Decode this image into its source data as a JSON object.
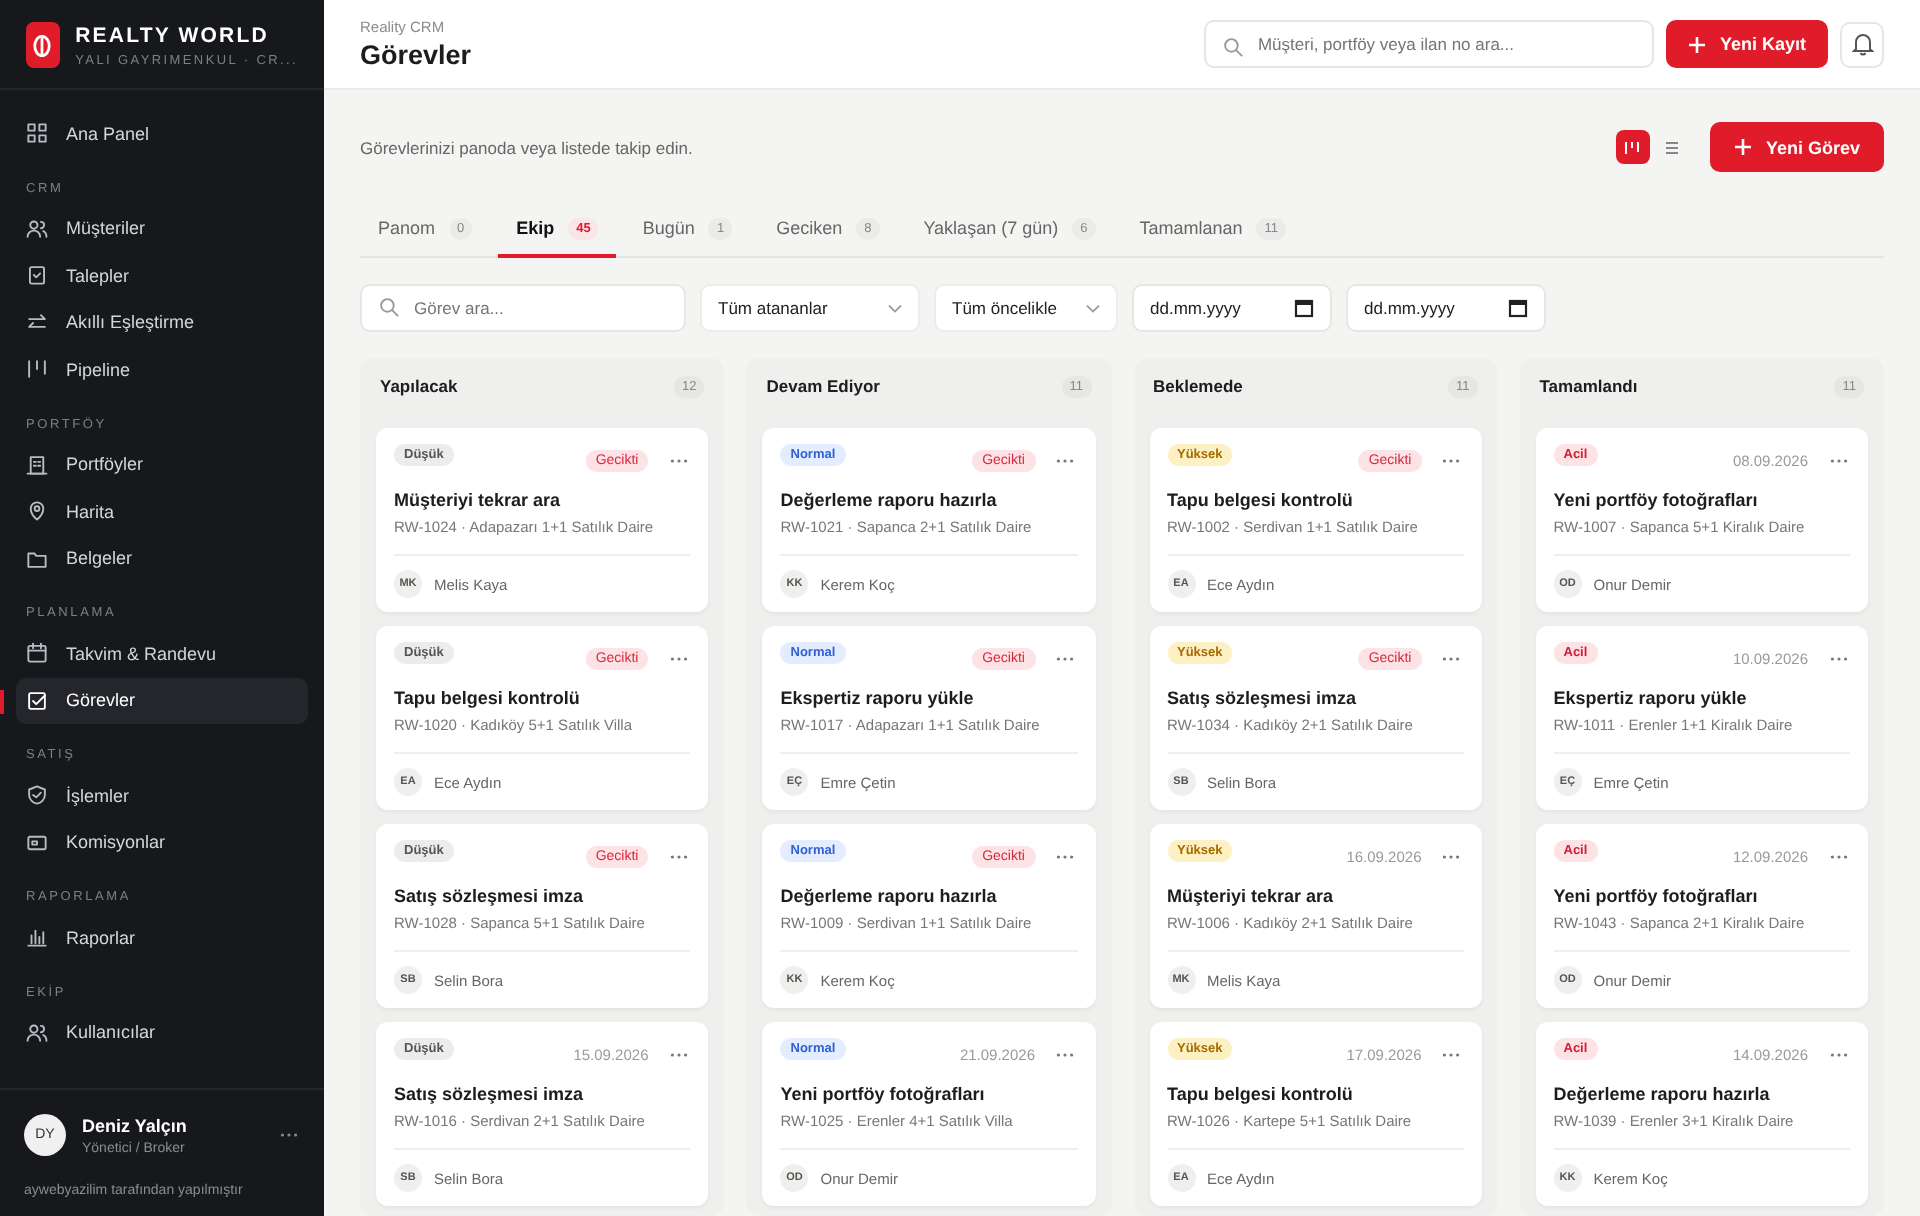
{
  "brand": {
    "name": "REALTY WORLD",
    "subtitle": "YALI GAYRIMENKUL · CR..."
  },
  "sidebar": {
    "sections": [
      {
        "items": [
          {
            "label": "Ana Panel",
            "selected": false
          }
        ]
      },
      {
        "heading": "CRM",
        "items": [
          {
            "label": "Müşteriler",
            "selected": false
          },
          {
            "label": "Talepler",
            "selected": false
          },
          {
            "label": "Akıllı Eşleştirme",
            "selected": false
          },
          {
            "label": "Pipeline",
            "selected": false
          }
        ]
      },
      {
        "heading": "PORTFÖY",
        "items": [
          {
            "label": "Portföyler",
            "selected": false
          },
          {
            "label": "Harita",
            "selected": false
          },
          {
            "label": "Belgeler",
            "selected": false
          }
        ]
      },
      {
        "heading": "PLANLAMA",
        "items": [
          {
            "label": "Takvim & Randevu",
            "selected": false
          },
          {
            "label": "Görevler",
            "selected": true
          }
        ]
      },
      {
        "heading": "SATIŞ",
        "items": [
          {
            "label": "İşlemler",
            "selected": false
          },
          {
            "label": "Komisyonlar",
            "selected": false
          }
        ]
      },
      {
        "heading": "RAPORLAMA",
        "items": [
          {
            "label": "Raporlar",
            "selected": false
          }
        ]
      },
      {
        "heading": "EKİP",
        "items": [
          {
            "label": "Kullanıcılar",
            "selected": false
          }
        ]
      }
    ],
    "user": {
      "initials": "DY",
      "name": "Deniz Yalçın",
      "role": "Yönetici / Broker"
    },
    "footer": "aywebyazilim tarafından yapılmıştır"
  },
  "header": {
    "breadcrumb": "Reality CRM",
    "title": "Görevler",
    "search": {
      "placeholder": "Müşteri, portföy veya ilan no ara..."
    },
    "new_button": "Yeni Kayıt"
  },
  "description": "Görevlerinizi panoda veya listede takip edin.",
  "view_toggle": [
    {
      "kind": "board",
      "selected": true
    },
    {
      "kind": "list",
      "selected": false
    }
  ],
  "new_task_button": "Yeni Görev",
  "tabs": [
    {
      "label": "Panom",
      "count": "0",
      "selected": false
    },
    {
      "label": "Ekip",
      "count": "45",
      "selected": true
    },
    {
      "label": "Bugün",
      "count": "1",
      "selected": false
    },
    {
      "label": "Geciken",
      "count": "8",
      "selected": false
    },
    {
      "label": "Yaklaşan (7 gün)",
      "count": "6",
      "selected": false
    },
    {
      "label": "Tamamlanan",
      "count": "11",
      "selected": false
    }
  ],
  "filters": {
    "search": {
      "placeholder": "Görev ara..."
    },
    "selects": [
      {
        "value": "Tüm atananlar"
      },
      {
        "value": "Tüm öncelikle"
      }
    ],
    "dates": [
      {
        "placeholder": "dd.mm.yyyy"
      },
      {
        "placeholder": "dd.mm.yyyy"
      }
    ]
  },
  "columns": [
    {
      "title": "Yapılacak",
      "count": "12",
      "cards": [
        {
          "priority": {
            "kind": "low",
            "label": "Düşük"
          },
          "due": {
            "kind": "overdue",
            "text": "Gecikti"
          },
          "title": "Müşteriyi tekrar ara",
          "ref": "RW-1024 · Adapazarı 1+1 Satılık Daire",
          "initials": "MK",
          "assignee": "Melis Kaya"
        },
        {
          "priority": {
            "kind": "low",
            "label": "Düşük"
          },
          "due": {
            "kind": "overdue",
            "text": "Gecikti"
          },
          "title": "Tapu belgesi kontrolü",
          "ref": "RW-1020 · Kadıköy 5+1 Satılık Villa",
          "initials": "EA",
          "assignee": "Ece Aydın"
        },
        {
          "priority": {
            "kind": "low",
            "label": "Düşük"
          },
          "due": {
            "kind": "overdue",
            "text": "Gecikti"
          },
          "title": "Satış sözleşmesi imza",
          "ref": "RW-1028 · Sapanca 5+1 Satılık Daire",
          "initials": "SB",
          "assignee": "Selin Bora"
        },
        {
          "priority": {
            "kind": "low",
            "label": "Düşük"
          },
          "due": {
            "kind": "date",
            "text": "15.09.2026"
          },
          "title": "Satış sözleşmesi imza",
          "ref": "RW-1016 · Serdivan 2+1 Satılık Daire",
          "initials": "SB",
          "assignee": "Selin Bora"
        }
      ]
    },
    {
      "title": "Devam Ediyor",
      "count": "11",
      "cards": [
        {
          "priority": {
            "kind": "normal",
            "label": "Normal"
          },
          "due": {
            "kind": "overdue",
            "text": "Gecikti"
          },
          "title": "Değerleme raporu hazırla",
          "ref": "RW-1021 · Sapanca 2+1 Satılık Daire",
          "initials": "KK",
          "assignee": "Kerem Koç"
        },
        {
          "priority": {
            "kind": "normal",
            "label": "Normal"
          },
          "due": {
            "kind": "overdue",
            "text": "Gecikti"
          },
          "title": "Ekspertiz raporu yükle",
          "ref": "RW-1017 · Adapazarı 1+1 Satılık Daire",
          "initials": "EÇ",
          "assignee": "Emre Çetin"
        },
        {
          "priority": {
            "kind": "normal",
            "label": "Normal"
          },
          "due": {
            "kind": "overdue",
            "text": "Gecikti"
          },
          "title": "Değerleme raporu hazırla",
          "ref": "RW-1009 · Serdivan 1+1 Satılık Daire",
          "initials": "KK",
          "assignee": "Kerem Koç"
        },
        {
          "priority": {
            "kind": "normal",
            "label": "Normal"
          },
          "due": {
            "kind": "date",
            "text": "21.09.2026"
          },
          "title": "Yeni portföy fotoğrafları",
          "ref": "RW-1025 · Erenler 4+1 Satılık Villa",
          "initials": "OD",
          "assignee": "Onur Demir"
        }
      ]
    },
    {
      "title": "Beklemede",
      "count": "11",
      "cards": [
        {
          "priority": {
            "kind": "high",
            "label": "Yüksek"
          },
          "due": {
            "kind": "overdue",
            "text": "Gecikti"
          },
          "title": "Tapu belgesi kontrolü",
          "ref": "RW-1002 · Serdivan 1+1 Satılık Daire",
          "initials": "EA",
          "assignee": "Ece Aydın"
        },
        {
          "priority": {
            "kind": "high",
            "label": "Yüksek"
          },
          "due": {
            "kind": "overdue",
            "text": "Gecikti"
          },
          "title": "Satış sözleşmesi imza",
          "ref": "RW-1034 · Kadıköy 2+1 Satılık Daire",
          "initials": "SB",
          "assignee": "Selin Bora"
        },
        {
          "priority": {
            "kind": "high",
            "label": "Yüksek"
          },
          "due": {
            "kind": "date",
            "text": "16.09.2026"
          },
          "title": "Müşteriyi tekrar ara",
          "ref": "RW-1006 · Kadıköy 2+1 Satılık Daire",
          "initials": "MK",
          "assignee": "Melis Kaya"
        },
        {
          "priority": {
            "kind": "high",
            "label": "Yüksek"
          },
          "due": {
            "kind": "date",
            "text": "17.09.2026"
          },
          "title": "Tapu belgesi kontrolü",
          "ref": "RW-1026 · Kartepe 5+1 Satılık Daire",
          "initials": "EA",
          "assignee": "Ece Aydın"
        }
      ]
    },
    {
      "title": "Tamamlandı",
      "count": "11",
      "cards": [
        {
          "priority": {
            "kind": "urgent",
            "label": "Acil"
          },
          "due": {
            "kind": "date",
            "text": "08.09.2026"
          },
          "title": "Yeni portföy fotoğrafları",
          "ref": "RW-1007 · Sapanca 5+1 Kiralık Daire",
          "initials": "OD",
          "assignee": "Onur Demir"
        },
        {
          "priority": {
            "kind": "urgent",
            "label": "Acil"
          },
          "due": {
            "kind": "date",
            "text": "10.09.2026"
          },
          "title": "Ekspertiz raporu yükle",
          "ref": "RW-1011 · Erenler 1+1 Kiralık Daire",
          "initials": "EÇ",
          "assignee": "Emre Çetin"
        },
        {
          "priority": {
            "kind": "urgent",
            "label": "Acil"
          },
          "due": {
            "kind": "date",
            "text": "12.09.2026"
          },
          "title": "Yeni portföy fotoğrafları",
          "ref": "RW-1043 · Sapanca 2+1 Kiralık Daire",
          "initials": "OD",
          "assignee": "Onur Demir"
        },
        {
          "priority": {
            "kind": "urgent",
            "label": "Acil"
          },
          "due": {
            "kind": "date",
            "text": "14.09.2026"
          },
          "title": "Değerleme raporu hazırla",
          "ref": "RW-1039 · Erenler 3+1 Kiralık Daire",
          "initials": "KK",
          "assignee": "Kerem Koç"
        }
      ]
    }
  ]
}
